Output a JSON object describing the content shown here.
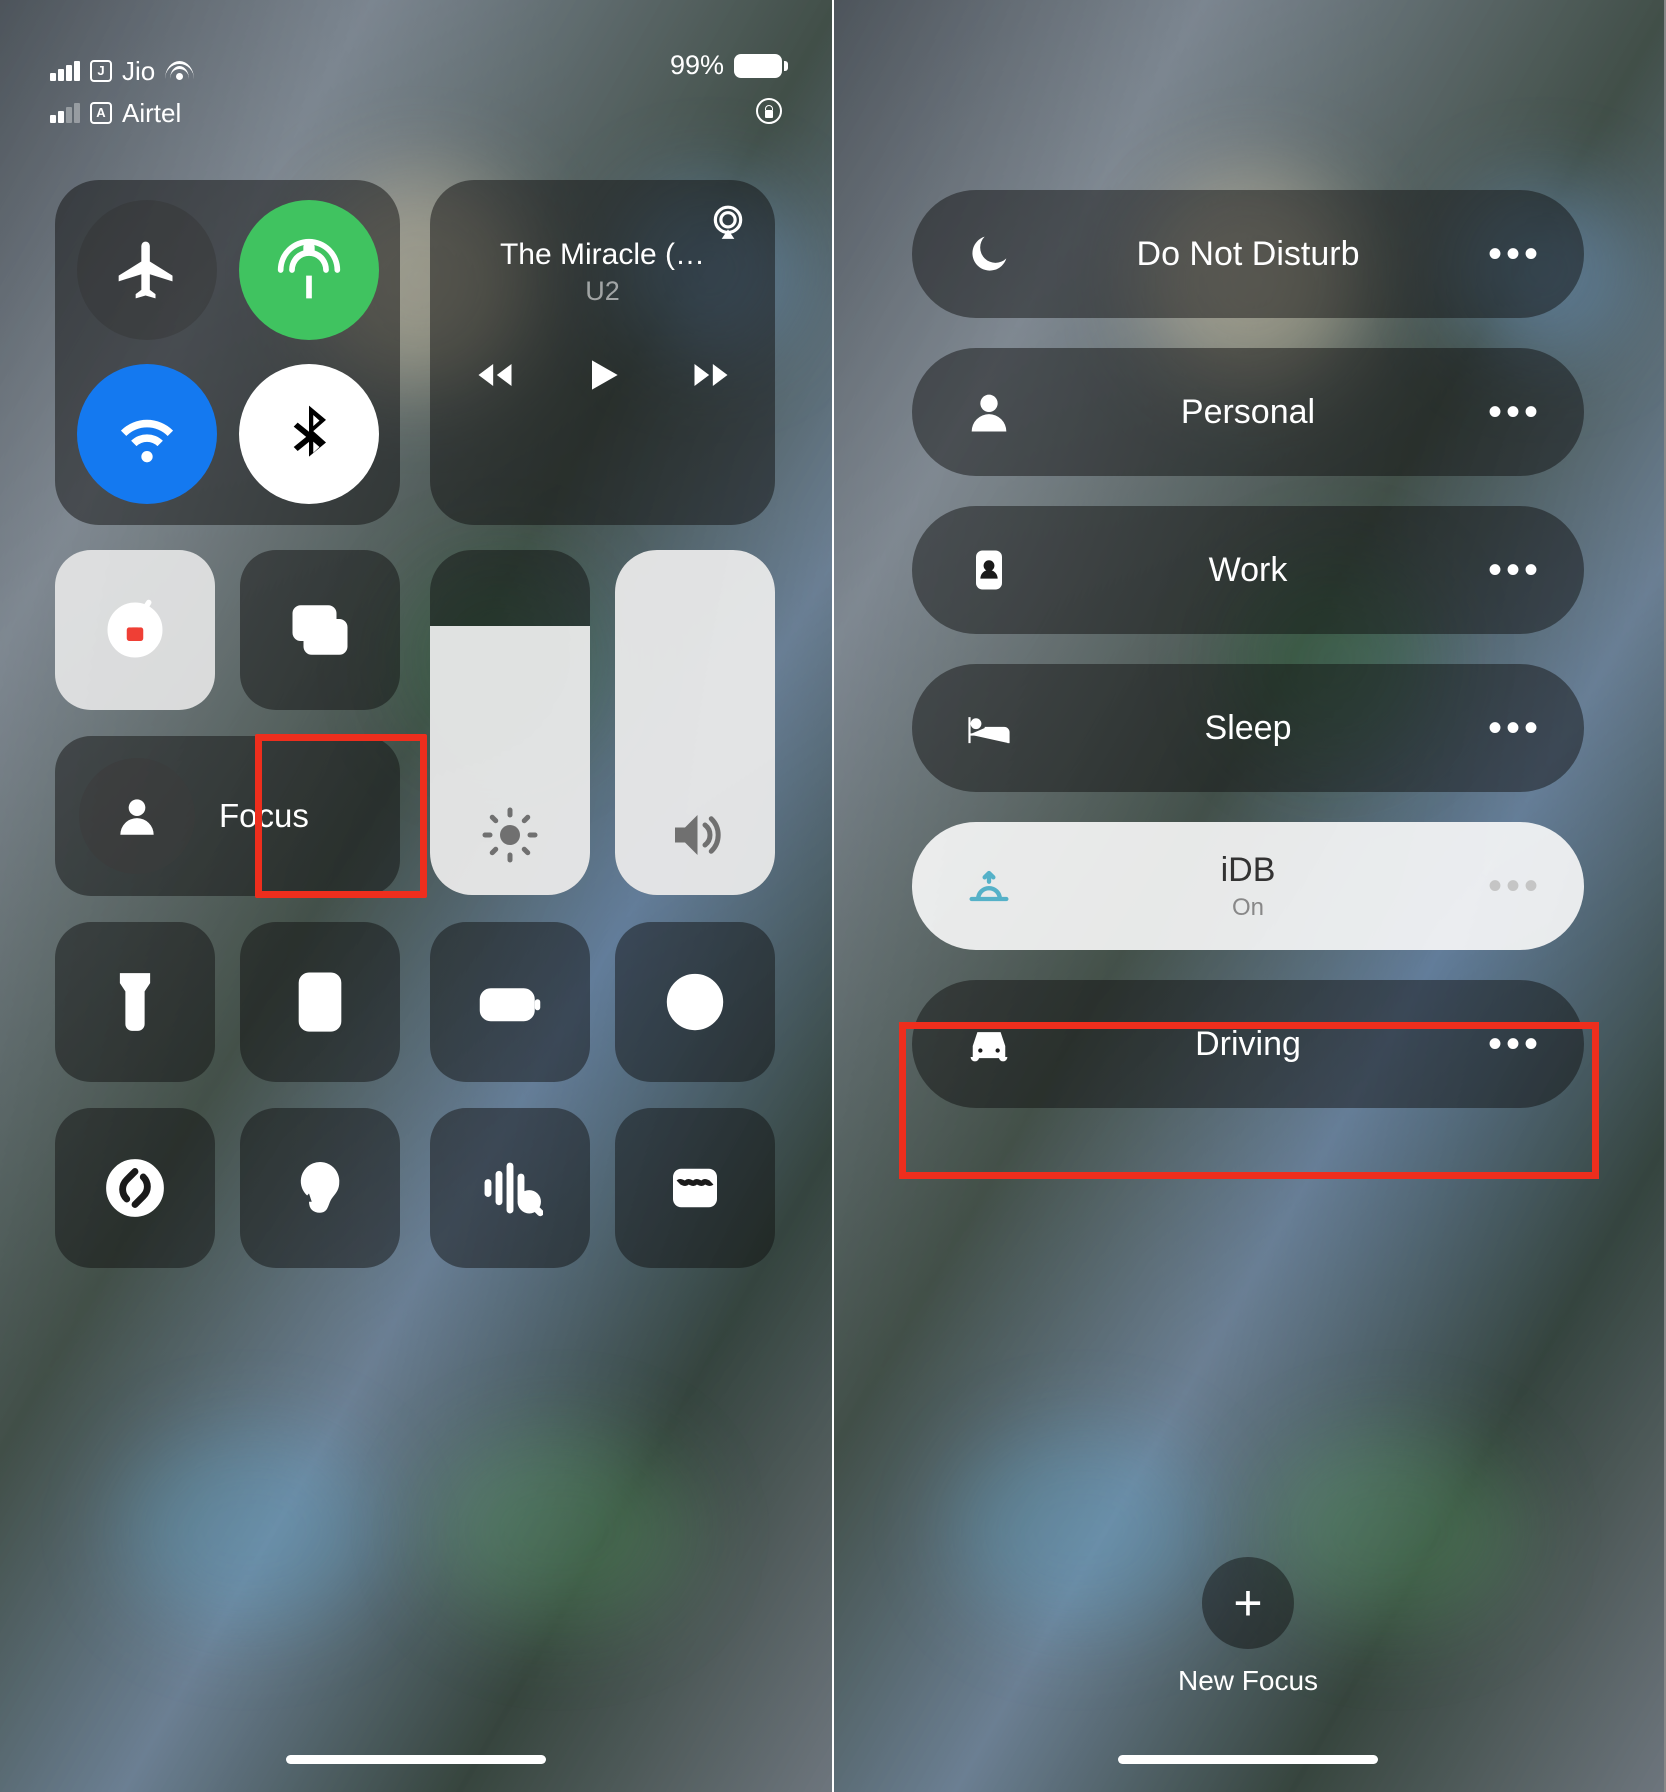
{
  "status": {
    "sim1": {
      "signal": 4,
      "label": "J",
      "carrier": "Jio"
    },
    "sim2": {
      "signal": 2,
      "label": "A",
      "carrier": "Airtel"
    },
    "battery_pct": "99%",
    "orientation_lock_icon": "orientation-lock"
  },
  "connectivity": {
    "airplane": "airplane-icon",
    "cellular": "cellular-antenna-icon",
    "wifi": "wifi-icon",
    "bluetooth": "bluetooth-icon"
  },
  "media": {
    "title": "The Miracle (…",
    "artist": "U2",
    "airplay_icon": "airplay-icon"
  },
  "tiles": {
    "orientation_lock": "orientation-lock-icon",
    "screen_mirroring": "screen-mirroring-icon",
    "focus_label": "Focus",
    "brightness_icon": "brightness-icon",
    "volume_icon": "volume-icon",
    "flashlight": "flashlight-icon",
    "calculator": "calculator-icon",
    "low_power": "low-power-icon",
    "screen_record": "screen-record-icon",
    "shazam": "shazam-icon",
    "hearing": "hearing-icon",
    "sound_recognition": "sound-recognition-icon",
    "quick_note": "quick-note-icon"
  },
  "sliders": {
    "brightness_pct": 78,
    "volume_pct": 100
  },
  "focus_modes": [
    {
      "icon": "moon",
      "label": "Do Not Disturb",
      "selected": false
    },
    {
      "icon": "person",
      "label": "Personal",
      "selected": false
    },
    {
      "icon": "badge",
      "label": "Work",
      "selected": false
    },
    {
      "icon": "bed",
      "label": "Sleep",
      "selected": false
    },
    {
      "icon": "sunrise",
      "label": "iDB",
      "sub": "On",
      "selected": true
    },
    {
      "icon": "car",
      "label": "Driving",
      "selected": false
    }
  ],
  "new_focus": {
    "label": "New Focus"
  }
}
